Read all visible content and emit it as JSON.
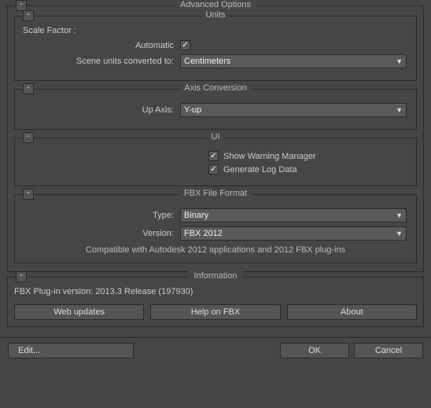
{
  "advanced": {
    "title": "Advanced Options",
    "units": {
      "title": "Units",
      "scale_factor_label": "Scale Factor :",
      "automatic_label": "Automatic",
      "automatic_checked": true,
      "converted_label": "Scene units converted to:",
      "converted_value": "Centimeters"
    },
    "axis": {
      "title": "Axis Conversion",
      "up_axis_label": "Up Axis:",
      "up_axis_value": "Y-up"
    },
    "ui": {
      "title": "UI",
      "warning_label": "Show Warning Manager",
      "warning_checked": true,
      "log_label": "Generate Log Data",
      "log_checked": true
    },
    "fbx": {
      "title": "FBX File Format",
      "type_label": "Type:",
      "type_value": "Binary",
      "version_label": "Version:",
      "version_value": "FBX 2012",
      "compat_text": "Compatible with Autodesk 2012 applications and 2012 FBX plug-ins"
    }
  },
  "information": {
    "title": "Information",
    "plugin_version": "FBX Plug-in version: 2013.3 Release (197930)",
    "buttons": {
      "web": "Web updates",
      "help": "Help on FBX",
      "about": "About"
    }
  },
  "bottom": {
    "edit": "Edit...",
    "ok": "OK",
    "cancel": "Cancel"
  },
  "collapse_glyph": "-"
}
